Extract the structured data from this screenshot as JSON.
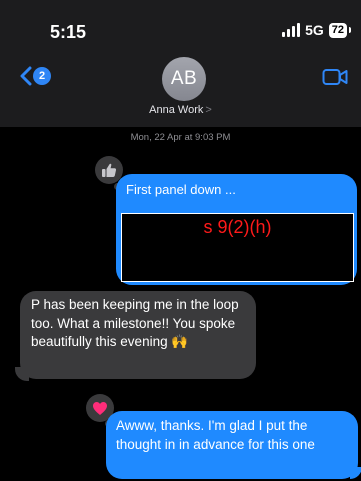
{
  "status_bar": {
    "time": "5:15",
    "network": "5G",
    "battery": "72"
  },
  "header": {
    "back_badge": "2",
    "avatar_initials": "AB",
    "contact_name": "Anna Work",
    "contact_chevron": ">",
    "back_icon": "chevron-left-icon",
    "video_icon": "video-camera-icon"
  },
  "conversation": {
    "timestamp": "Mon, 22 Apr at 9:03 PM",
    "messages": [
      {
        "direction": "outgoing",
        "text": "First panel down ...",
        "redaction_label": "s 9(2)(h)",
        "tapback": "thumbs-up-icon"
      },
      {
        "direction": "incoming",
        "text": "P has been keeping me in the loop too. What a milestone!! You spoke beautifully this evening 🙌"
      },
      {
        "direction": "outgoing",
        "text": "Awww, thanks. I'm glad I put the thought in in advance for this one",
        "tapback": "heart-icon"
      }
    ]
  },
  "colors": {
    "outgoing_bubble": "#1f8aff",
    "incoming_bubble": "#3a3a3c",
    "redaction_text": "#ff1a1a",
    "heart": "#ff2d7a"
  }
}
